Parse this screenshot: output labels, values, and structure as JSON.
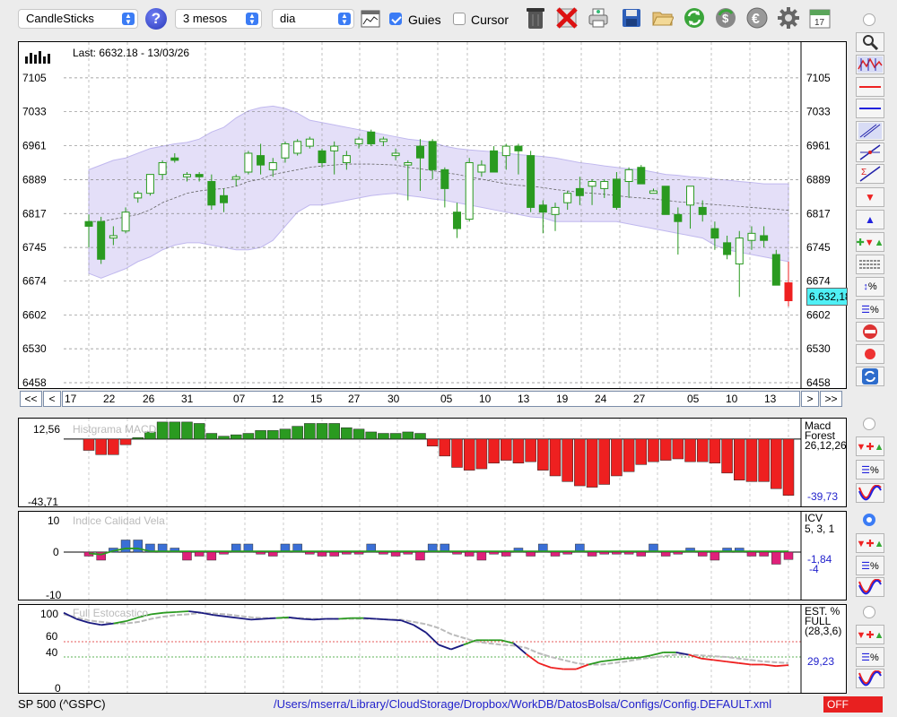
{
  "toolbar": {
    "chart_type": "CandleSticks",
    "period": "3 mesos",
    "interval": "dia",
    "guides_label": "Guies",
    "guides_checked": true,
    "cursor_label": "Cursor",
    "cursor_checked": false
  },
  "main_chart": {
    "last_label": "Last: 6632.18 - 13/03/26",
    "price_tag": "6.632,18",
    "price_ticks": [
      "7105",
      "7033",
      "6961",
      "6889",
      "6817",
      "6745",
      "6674",
      "6602",
      "6530",
      "6458"
    ],
    "date_labels": [
      "17",
      "22",
      "26",
      "31",
      "07",
      "12",
      "15",
      "27",
      "30",
      "05",
      "10",
      "13",
      "19",
      "24",
      "27",
      "05",
      "10",
      "13"
    ],
    "nav": {
      "first": "<<",
      "prev": "<",
      "next": ">",
      "last": ">>"
    }
  },
  "macd_panel": {
    "title": "Histgrama MACD",
    "top_value": "12,56",
    "bottom_value": "-43,71",
    "legend_name": "Macd",
    "legend_sub": "Forest",
    "legend_params": "26,12,26",
    "current_value": "-39,73"
  },
  "icv_panel": {
    "title": "Indice Calidad Vela",
    "ticks": [
      "10",
      "0",
      "-10"
    ],
    "legend_name": "ICV",
    "legend_params": "5, 3, 1",
    "value1": "-1,84",
    "value2": "-4"
  },
  "stoch_panel": {
    "title": "Full Estocastico",
    "ticks": [
      "100",
      "60",
      "40",
      "0"
    ],
    "legend_name": "EST. %",
    "legend_sub": "FULL",
    "legend_params": "(28,3,6)",
    "current_value": "29,23"
  },
  "status": {
    "symbol": "SP 500 (^GSPC)",
    "config_path": "/Users/mserra/Library/CloudStorage/Dropbox/WorkDB/DatosBolsa/Configs/Config.DEFAULT.xml",
    "off_label": "OFF"
  },
  "colors": {
    "up": "#2a9a20",
    "down": "#ee2020",
    "band": "#d8d2f5",
    "icv_up": "#3a6fd6",
    "icv_down": "#e0207a",
    "cyan_tag": "#4ff0f5"
  },
  "chart_data": {
    "type": "candlestick",
    "ylim": [
      6458,
      7177
    ],
    "candles": [
      {
        "o": 6800,
        "h": 6815,
        "l": 6745,
        "c": 6790
      },
      {
        "o": 6800,
        "h": 6810,
        "l": 6710,
        "c": 6720
      },
      {
        "o": 6765,
        "h": 6790,
        "l": 6750,
        "c": 6770
      },
      {
        "o": 6780,
        "h": 6830,
        "l": 6775,
        "c": 6820
      },
      {
        "o": 6850,
        "h": 6865,
        "l": 6840,
        "c": 6860
      },
      {
        "o": 6860,
        "h": 6900,
        "l": 6855,
        "c": 6900
      },
      {
        "o": 6900,
        "h": 6930,
        "l": 6890,
        "c": 6925
      },
      {
        "o": 6935,
        "h": 6945,
        "l": 6925,
        "c": 6930
      },
      {
        "o": 6895,
        "h": 6905,
        "l": 6885,
        "c": 6900
      },
      {
        "o": 6900,
        "h": 6905,
        "l": 6885,
        "c": 6895
      },
      {
        "o": 6885,
        "h": 6900,
        "l": 6825,
        "c": 6835
      },
      {
        "o": 6855,
        "h": 6870,
        "l": 6820,
        "c": 6840
      },
      {
        "o": 6890,
        "h": 6900,
        "l": 6875,
        "c": 6895
      },
      {
        "o": 6905,
        "h": 6950,
        "l": 6900,
        "c": 6945
      },
      {
        "o": 6940,
        "h": 6965,
        "l": 6900,
        "c": 6920
      },
      {
        "o": 6910,
        "h": 6935,
        "l": 6895,
        "c": 6925
      },
      {
        "o": 6935,
        "h": 6970,
        "l": 6925,
        "c": 6965
      },
      {
        "o": 6945,
        "h": 6975,
        "l": 6940,
        "c": 6970
      },
      {
        "o": 6960,
        "h": 6980,
        "l": 6955,
        "c": 6975
      },
      {
        "o": 6950,
        "h": 6955,
        "l": 6915,
        "c": 6925
      },
      {
        "o": 6950,
        "h": 6970,
        "l": 6900,
        "c": 6960
      },
      {
        "o": 6925,
        "h": 6950,
        "l": 6910,
        "c": 6940
      },
      {
        "o": 6965,
        "h": 6980,
        "l": 6955,
        "c": 6975
      },
      {
        "o": 6990,
        "h": 6995,
        "l": 6960,
        "c": 6965
      },
      {
        "o": 6970,
        "h": 6980,
        "l": 6960,
        "c": 6975
      },
      {
        "o": 6940,
        "h": 6955,
        "l": 6930,
        "c": 6945
      },
      {
        "o": 6920,
        "h": 6930,
        "l": 6845,
        "c": 6925
      },
      {
        "o": 6960,
        "h": 6975,
        "l": 6865,
        "c": 6935
      },
      {
        "o": 6970,
        "h": 6975,
        "l": 6890,
        "c": 6910
      },
      {
        "o": 6910,
        "h": 6915,
        "l": 6830,
        "c": 6870
      },
      {
        "o": 6820,
        "h": 6840,
        "l": 6765,
        "c": 6785
      },
      {
        "o": 6805,
        "h": 6935,
        "l": 6800,
        "c": 6925
      },
      {
        "o": 6905,
        "h": 6930,
        "l": 6895,
        "c": 6920
      },
      {
        "o": 6950,
        "h": 6960,
        "l": 6905,
        "c": 6905
      },
      {
        "o": 6940,
        "h": 6965,
        "l": 6910,
        "c": 6960
      },
      {
        "o": 6960,
        "h": 6965,
        "l": 6900,
        "c": 6950
      },
      {
        "o": 6940,
        "h": 6950,
        "l": 6820,
        "c": 6830
      },
      {
        "o": 6835,
        "h": 6845,
        "l": 6775,
        "c": 6820
      },
      {
        "o": 6815,
        "h": 6840,
        "l": 6780,
        "c": 6830
      },
      {
        "o": 6840,
        "h": 6865,
        "l": 6825,
        "c": 6860
      },
      {
        "o": 6870,
        "h": 6895,
        "l": 6835,
        "c": 6855
      },
      {
        "o": 6875,
        "h": 6890,
        "l": 6835,
        "c": 6885
      },
      {
        "o": 6870,
        "h": 6890,
        "l": 6850,
        "c": 6885
      },
      {
        "o": 6890,
        "h": 6905,
        "l": 6825,
        "c": 6830
      },
      {
        "o": 6885,
        "h": 6915,
        "l": 6850,
        "c": 6910
      },
      {
        "o": 6915,
        "h": 6920,
        "l": 6880,
        "c": 6880
      },
      {
        "o": 6860,
        "h": 6870,
        "l": 6860,
        "c": 6865
      },
      {
        "o": 6875,
        "h": 6875,
        "l": 6820,
        "c": 6815
      },
      {
        "o": 6815,
        "h": 6830,
        "l": 6730,
        "c": 6800
      },
      {
        "o": 6835,
        "h": 6855,
        "l": 6785,
        "c": 6875
      },
      {
        "o": 6830,
        "h": 6845,
        "l": 6800,
        "c": 6815
      },
      {
        "o": 6785,
        "h": 6800,
        "l": 6740,
        "c": 6765
      },
      {
        "o": 6755,
        "h": 6770,
        "l": 6720,
        "c": 6730
      },
      {
        "o": 6710,
        "h": 6780,
        "l": 6640,
        "c": 6765
      },
      {
        "o": 6760,
        "h": 6790,
        "l": 6740,
        "c": 6775
      },
      {
        "o": 6770,
        "h": 6790,
        "l": 6745,
        "c": 6760
      },
      {
        "o": 6730,
        "h": 6740,
        "l": 6665,
        "c": 6665
      },
      {
        "o": 6670,
        "h": 6715,
        "l": 6620,
        "c": 6632
      }
    ],
    "bollinger": {
      "upper": [
        6910,
        6920,
        6930,
        6935,
        6945,
        6955,
        6960,
        6965,
        6968,
        6975,
        6990,
        7000,
        7020,
        7035,
        7042,
        7045,
        7040,
        7030,
        7015,
        7010,
        7005,
        7000,
        6995,
        6990,
        6985,
        6980,
        6975,
        6972,
        6968,
        6960,
        6955,
        6952,
        6950,
        6948,
        6945,
        6942,
        6940,
        6938,
        6935,
        6930,
        6925,
        6922,
        6918,
        6915,
        6912,
        6910,
        6905,
        6900,
        6898,
        6895,
        6893,
        6890,
        6888,
        6885,
        6883,
        6880,
        6880,
        6880
      ],
      "middle": [
        6800,
        6800,
        6805,
        6810,
        6815,
        6825,
        6840,
        6850,
        6860,
        6865,
        6868,
        6870,
        6875,
        6885,
        6890,
        6900,
        6905,
        6910,
        6915,
        6918,
        6920,
        6922,
        6922,
        6922,
        6921,
        6920,
        6915,
        6912,
        6908,
        6904,
        6900,
        6895,
        6890,
        6885,
        6880,
        6877,
        6875,
        6872,
        6868,
        6865,
        6862,
        6860,
        6858,
        6855,
        6852,
        6850,
        6848,
        6845,
        6842,
        6840,
        6838,
        6836,
        6834,
        6832,
        6830,
        6828,
        6826,
        6824
      ],
      "lower": [
        6690,
        6680,
        6690,
        6700,
        6715,
        6725,
        6740,
        6750,
        6755,
        6755,
        6750,
        6745,
        6740,
        6740,
        6745,
        6760,
        6790,
        6820,
        6835,
        6835,
        6840,
        6845,
        6850,
        6855,
        6858,
        6860,
        6855,
        6852,
        6848,
        6845,
        6840,
        6835,
        6830,
        6825,
        6820,
        6815,
        6810,
        6808,
        6800,
        6800,
        6800,
        6800,
        6800,
        6800,
        6795,
        6790,
        6785,
        6780,
        6775,
        6770,
        6765,
        6750,
        6740,
        6735,
        6730,
        6725,
        6720,
        6715
      ]
    },
    "macd_hist": [
      -8,
      -11,
      -11,
      -4,
      1,
      5,
      12,
      12,
      12,
      11,
      4,
      2,
      3,
      4,
      6,
      6,
      7,
      9,
      11,
      11,
      11,
      8,
      7,
      5,
      4,
      4,
      5,
      4,
      -5,
      -12,
      -20,
      -22,
      -21,
      -17,
      -15,
      -17,
      -16,
      -22,
      -26,
      -30,
      -33,
      -34,
      -32,
      -26,
      -23,
      -18,
      -16,
      -15,
      -14,
      -16,
      -16,
      -17,
      -24,
      -29,
      -30,
      -30,
      -35,
      -39.73
    ],
    "icv": [
      -1,
      -2,
      1,
      3,
      3,
      2,
      2,
      1,
      -2,
      -1,
      -2,
      -0.5,
      2,
      2,
      -0.5,
      -1,
      2,
      2,
      -0.5,
      -1,
      -1,
      -0.5,
      -0.5,
      2,
      -0.5,
      -1,
      -0.5,
      -2,
      2,
      2,
      -0.5,
      -1,
      -2,
      -0.5,
      -1,
      1,
      -1,
      2,
      -1,
      -0.5,
      2,
      -1,
      -0.5,
      -0.5,
      -0.5,
      -1,
      2,
      -1,
      -0.5,
      1,
      -1,
      -2,
      1,
      1,
      -1,
      -1,
      -3,
      -1.84
    ],
    "stoch_k": [
      98,
      90,
      85,
      82,
      84,
      87,
      92,
      96,
      98,
      99,
      100,
      98,
      95,
      93,
      91,
      89,
      90,
      91,
      92,
      90,
      89,
      90,
      90,
      91,
      91,
      90,
      89,
      88,
      82,
      72,
      56,
      50,
      56,
      62,
      62,
      62,
      58,
      44,
      32,
      26,
      24,
      24,
      30,
      34,
      36,
      38,
      39,
      42,
      46,
      46,
      43,
      38,
      36,
      34,
      32,
      30,
      30,
      28,
      29.23
    ],
    "stoch_d": [
      96,
      92,
      88,
      86,
      84,
      84,
      86,
      90,
      93,
      95,
      96,
      98,
      97,
      96,
      94,
      92,
      91,
      91,
      91,
      91,
      90,
      90,
      90,
      90,
      90,
      90,
      89,
      89,
      86,
      83,
      78,
      70,
      65,
      60,
      58,
      56,
      55,
      52,
      45,
      40,
      36,
      32,
      30,
      30,
      32,
      34,
      37,
      39,
      41,
      43,
      43,
      42,
      41,
      40,
      38,
      36,
      34,
      33,
      32
    ]
  }
}
